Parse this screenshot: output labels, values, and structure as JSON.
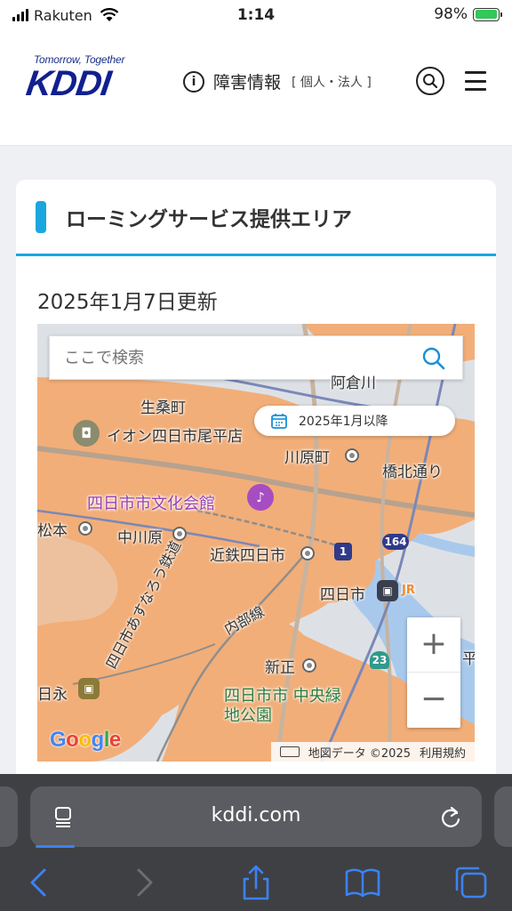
{
  "status_bar": {
    "carrier": "Rakuten",
    "time": "1:14",
    "battery_percent": "98%",
    "battery_level": 0.98
  },
  "header": {
    "tagline": "Tomorrow, Together",
    "logo_text": "KDDI",
    "info_label": "障害情報",
    "info_sub": "[ 個人・法人 ]"
  },
  "card": {
    "title": "ローミングサービス提供エリア",
    "updated": "2025年1月7日更新"
  },
  "map": {
    "search_placeholder": "ここで検索",
    "date_filter": "2025年1月以降",
    "labels": {
      "ikuwa": "生桑町",
      "aeon": "イオン四日市尾平店",
      "kawarada": "川原町",
      "kyobashi": "橋北通り",
      "bunka": "四日市市文化会館",
      "matsumoto": "松本",
      "nakagawara": "中川原",
      "kintetsu": "近鉄四日市",
      "yokkaichi": "四日市",
      "jr": "JR",
      "utsube": "内部線",
      "asunarou": "四日市あすなろう鉄道",
      "shinsho": "新正",
      "chuo_park": "四日市市 中央緑地公園",
      "hinaga": "日永",
      "akura": "阿倉川",
      "route_164": "164",
      "route_1": "1",
      "route_23": "23",
      "hiraza": "平"
    },
    "google": "Google",
    "attribution": "地図データ ©2025",
    "terms": "利用規約",
    "colors": {
      "coverage": "#f2ae78",
      "water": "#a9c9ec",
      "rail": "#7a88b8"
    }
  },
  "browser": {
    "url": "kddi.com"
  }
}
